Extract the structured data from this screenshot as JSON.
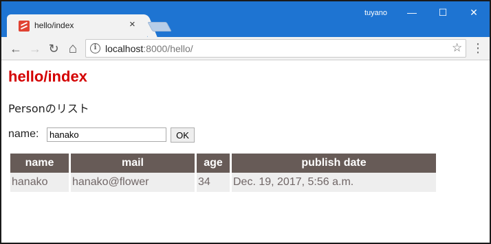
{
  "browser": {
    "tab_title": "hello/index",
    "tab_close": "×",
    "user": "tuyano",
    "window_controls": {
      "minimize": "—",
      "maximize": "☐",
      "close": "✕"
    },
    "nav": {
      "back": "←",
      "forward": "→",
      "reload": "↻",
      "home": "⌂"
    },
    "url_host": "localhost",
    "url_rest": ":8000/hello/",
    "bookmark_star": "☆",
    "menu": "⋮"
  },
  "page": {
    "title": "hello/index",
    "subtitle": "Personのリスト",
    "name_label": "name:",
    "name_value": "hanako",
    "ok_label": "OK"
  },
  "table": {
    "headers": [
      "name",
      "mail",
      "age",
      "publish date"
    ],
    "rows": [
      [
        "hanako",
        "hanako@flower",
        "34",
        "Dec. 19, 2017, 5:56 a.m."
      ]
    ]
  }
}
